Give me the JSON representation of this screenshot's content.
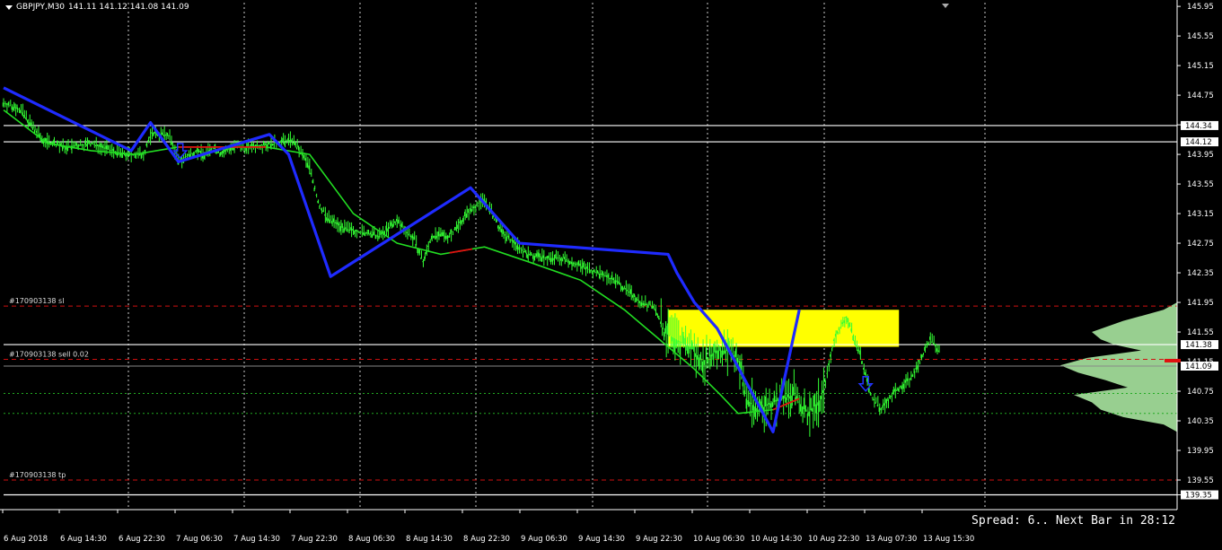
{
  "header": {
    "symbol": "GBPJPY,M30",
    "ohlc": "141.11 141.12 141.08 141.09"
  },
  "status": {
    "spread_text": "Spread: 6.. Next Bar in 28:12"
  },
  "colors": {
    "background": "#000000",
    "candles": "#33ff33",
    "zigzag": "#1f2bff",
    "ma_green": "#22dd22",
    "ma_red": "#e01010",
    "zone": "#ffff00",
    "volume_profile": "#a8e6a0",
    "order_line": "#d01010",
    "grid": "#ffffff",
    "arrow": "#2233ff"
  },
  "chart_data": {
    "type": "candlestick",
    "symbol": "GBPJPY",
    "timeframe": "M30",
    "ylim": [
      139.15,
      146.0
    ],
    "grid": true,
    "y_ticks": [
      "145.95",
      "145.55",
      "145.15",
      "144.75",
      "144.35",
      "143.95",
      "143.55",
      "143.15",
      "142.75",
      "142.35",
      "141.95",
      "141.55",
      "141.15",
      "140.75",
      "140.35",
      "139.95",
      "139.55",
      "139.35"
    ],
    "x_ticks": [
      "6 Aug 2018",
      "6 Aug 14:30",
      "6 Aug 22:30",
      "7 Aug 06:30",
      "7 Aug 14:30",
      "7 Aug 22:30",
      "8 Aug 06:30",
      "8 Aug 14:30",
      "8 Aug 22:30",
      "9 Aug 06:30",
      "9 Aug 14:30",
      "9 Aug 22:30",
      "10 Aug 06:30",
      "10 Aug 14:30",
      "10 Aug 22:30",
      "13 Aug 07:30",
      "13 Aug 15:30"
    ],
    "close_path": {
      "x": [
        0,
        10,
        22,
        35,
        50,
        60,
        70,
        80,
        85,
        95,
        100,
        110,
        115,
        120,
        125,
        130,
        140,
        155,
        165,
        175,
        180,
        185,
        195,
        205,
        215,
        225,
        235,
        240,
        245,
        255,
        265,
        275,
        285,
        300,
        310,
        320,
        330,
        340,
        350,
        365,
        372,
        378,
        385,
        393,
        400,
        408,
        415,
        420,
        425,
        432,
        440,
        452,
        460,
        468,
        475,
        482,
        490,
        496,
        502,
        510,
        520,
        530,
        535
      ],
      "y": [
        144.65,
        144.55,
        144.15,
        144.05,
        144.1,
        144.02,
        143.95,
        143.95,
        144.25,
        144.2,
        143.85,
        144.0,
        143.95,
        144.05,
        143.95,
        144.05,
        144.05,
        144.1,
        144.15,
        143.8,
        143.3,
        143.1,
        142.95,
        142.9,
        142.85,
        143.05,
        142.8,
        142.5,
        142.85,
        142.85,
        143.15,
        143.35,
        142.9,
        142.6,
        142.55,
        142.55,
        142.45,
        142.35,
        142.25,
        141.95,
        141.9,
        141.55,
        141.45,
        141.35,
        141.15,
        141.3,
        141.3,
        141.2,
        140.65,
        140.5,
        140.6,
        140.7,
        140.45,
        140.65,
        141.45,
        141.75,
        141.25,
        140.7,
        140.5,
        140.75,
        140.95,
        141.45,
        141.3
      ]
    },
    "zigzag": {
      "x": [
        0,
        73,
        84,
        100,
        152,
        163,
        187,
        267,
        295,
        380,
        385,
        395,
        408,
        440,
        455
      ],
      "y": [
        144.85,
        144.0,
        144.38,
        143.85,
        144.22,
        143.95,
        142.3,
        143.5,
        142.75,
        142.6,
        142.35,
        141.95,
        141.6,
        140.2,
        141.85
      ]
    },
    "moving_average": {
      "x": [
        0,
        25,
        50,
        75,
        100,
        130,
        150,
        175,
        200,
        225,
        250,
        275,
        300,
        330,
        355,
        375,
        395,
        410,
        420,
        440,
        450,
        455
      ],
      "y": [
        144.55,
        144.1,
        144.0,
        143.95,
        144.05,
        144.05,
        144.05,
        143.95,
        143.15,
        142.75,
        142.6,
        142.7,
        142.5,
        142.25,
        141.85,
        141.45,
        141.05,
        140.7,
        140.45,
        140.5,
        140.6,
        140.65
      ],
      "red_segments": [
        [
          100,
          150
        ],
        [
          255,
          268
        ],
        [
          440,
          455
        ]
      ]
    },
    "horizontal_levels": [
      {
        "price": 144.34,
        "color": "#ffffff",
        "label": "144.34"
      },
      {
        "price": 144.12,
        "color": "#ffffff",
        "label": "144.12"
      },
      {
        "price": 141.38,
        "color": "#ffffff",
        "label": "141.38"
      },
      {
        "price": 139.35,
        "color": "#ffffff",
        "label": "139.35"
      }
    ],
    "order_lines": [
      {
        "price": 141.9,
        "label": "#170903138 sl",
        "style": "dashed"
      },
      {
        "price": 141.18,
        "label": "#170903138 sell 0.02",
        "style": "dashed"
      },
      {
        "price": 139.55,
        "label": "#170903138 tp",
        "style": "dashed"
      }
    ],
    "current_price": {
      "price": 141.09,
      "label": "141.09"
    },
    "zone": {
      "x_from": 380,
      "x_to": 512,
      "price_top": 141.85,
      "price_bottom": 141.35
    },
    "arrows": [
      {
        "x": 101,
        "price": 144.0,
        "direction": "down"
      },
      {
        "x": 493,
        "price": 140.85,
        "direction": "down"
      }
    ]
  }
}
